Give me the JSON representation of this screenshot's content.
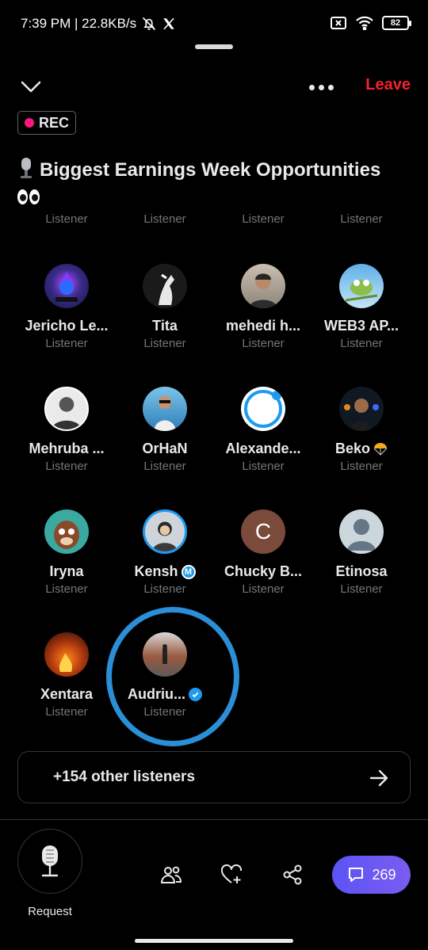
{
  "status_bar": {
    "time_text": "7:39 PM | 22.8KB/s",
    "battery": "82"
  },
  "header": {
    "leave_label": "Leave",
    "rec_label": "REC"
  },
  "space": {
    "title": "Biggest Earnings Week Opportunities"
  },
  "clipped_row": {
    "roles": [
      "Listener",
      "Listener",
      "Listener",
      "Listener"
    ]
  },
  "participants": [
    {
      "name": "Jericho Le...",
      "role": "Listener"
    },
    {
      "name": "Tita",
      "role": "Listener"
    },
    {
      "name": "mehedi h...",
      "role": "Listener"
    },
    {
      "name": "WEB3 AP...",
      "role": "Listener"
    },
    {
      "name": "Mehruba ...",
      "role": "Listener"
    },
    {
      "name": "OrHaN",
      "role": "Listener"
    },
    {
      "name": "Alexande...",
      "role": "Listener"
    },
    {
      "name": "Beko",
      "role": "Listener"
    },
    {
      "name": "Iryna",
      "role": "Listener"
    },
    {
      "name": "Kensh",
      "role": "Listener",
      "badge": "M"
    },
    {
      "name": "Chucky B...",
      "role": "Listener",
      "avatar_letter": "C"
    },
    {
      "name": "Etinosa",
      "role": "Listener"
    },
    {
      "name": "Xentara",
      "role": "Listener"
    },
    {
      "name": "Audriu...",
      "role": "Listener",
      "verified": true
    }
  ],
  "others": {
    "label": "+154 other listeners"
  },
  "bottom": {
    "request_label": "Request",
    "chat_count": "269"
  },
  "colors": {
    "leave": "#f4212e",
    "rec_dot": "#f91880",
    "accent": "#1d9bf0",
    "chat_gradient_start": "#5b54f5",
    "chat_gradient_end": "#7b5cf0"
  }
}
